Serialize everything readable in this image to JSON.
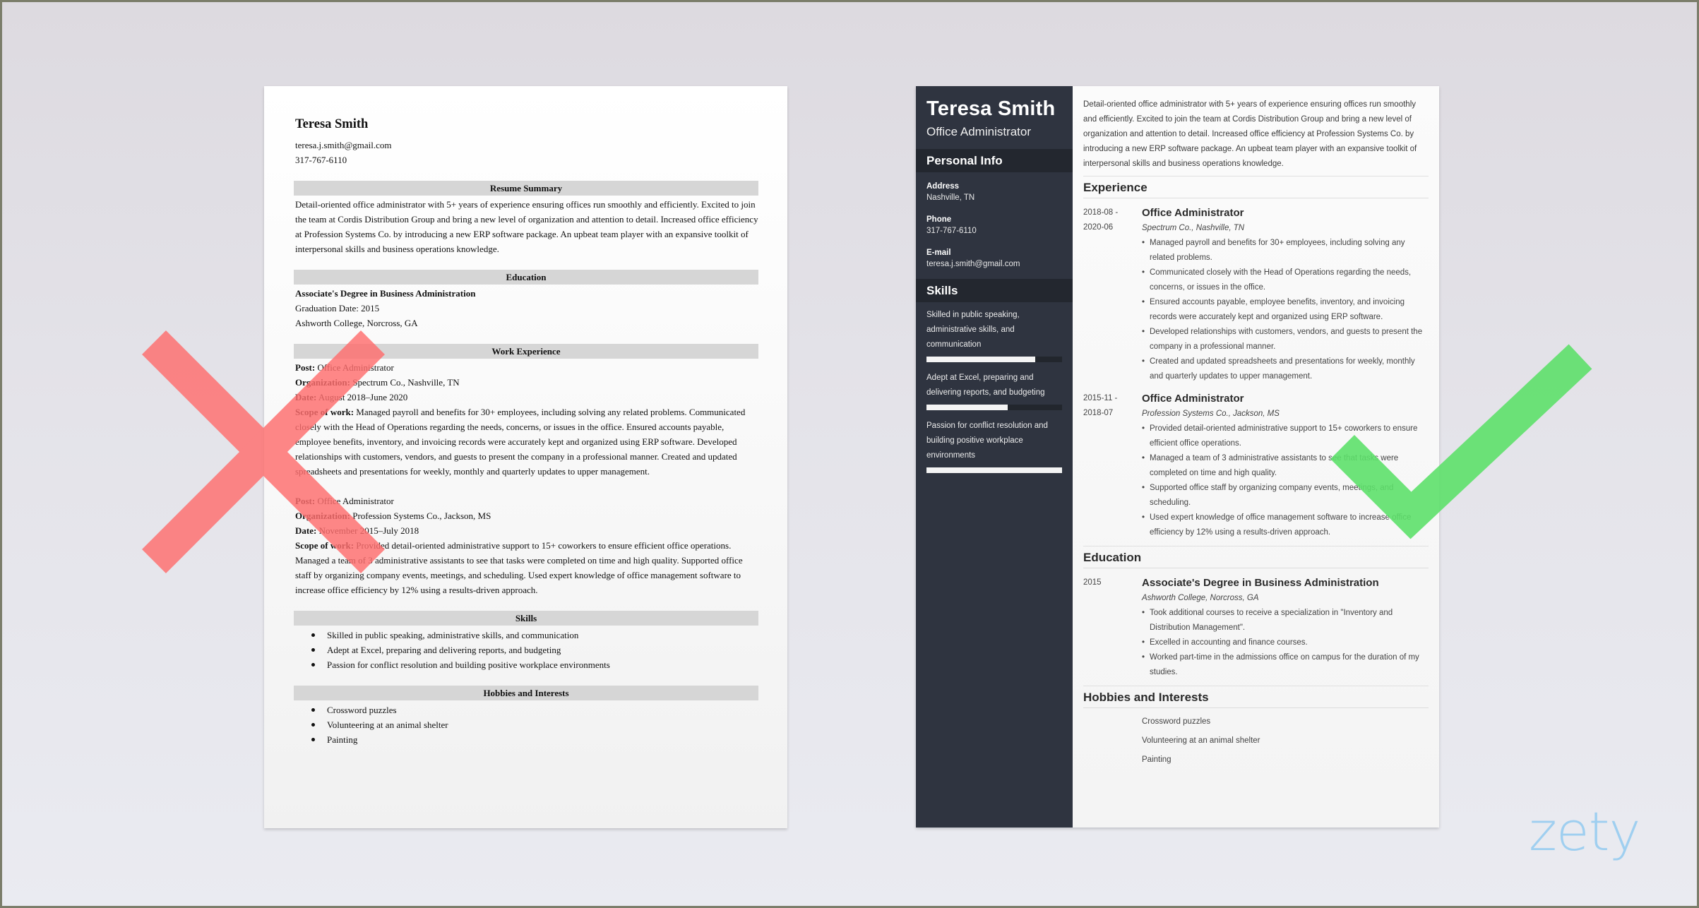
{
  "colors": {
    "bad_mark": "#ff6e6e",
    "good_mark": "#5de06a",
    "sidebar": "#2f3440",
    "sidebar_band": "#23272f",
    "logo": "#9fcff0"
  },
  "marks": {
    "bad": "x-icon",
    "good": "checkmark-icon"
  },
  "logo": {
    "text": "zety"
  },
  "left_resume": {
    "name": "Teresa Smith",
    "email": "teresa.j.smith@gmail.com",
    "phone": "317-767-6110",
    "summary_heading": "Resume Summary",
    "summary": "Detail-oriented office administrator with 5+ years of experience ensuring offices run smoothly and efficiently. Excited to join the team at Cordis Distribution Group and bring a new level of organization and attention to detail. Increased office efficiency at Profession Systems Co. by introducing a new ERP software package. An upbeat team player with an expansive toolkit of interpersonal skills and business operations knowledge.",
    "education_heading": "Education",
    "education": {
      "degree": "Associate's Degree in Business Administration",
      "graduation": "Graduation Date: 2015",
      "school": "Ashworth College, Norcross, GA"
    },
    "experience_heading": "Work Experience",
    "labels": {
      "post": "Post:",
      "organization": "Organization:",
      "date": "Date:",
      "scope": "Scope of work:"
    },
    "jobs": [
      {
        "post": "Office Administrator",
        "organization": "Spectrum Co., Nashville, TN",
        "date": "August 2018–June 2020",
        "scope": "Managed payroll and benefits for 30+ employees, including solving any related problems. Communicated closely with the Head of Operations regarding the needs, concerns, or issues in the office. Ensured accounts payable, employee benefits, inventory, and invoicing records were accurately kept and organized using ERP software. Developed relationships with customers, vendors, and guests to present the company in a professional manner. Created and updated spreadsheets and presentations for weekly, monthly and quarterly updates to upper management."
      },
      {
        "post": "Office Administrator",
        "organization": "Profession Systems Co., Jackson, MS",
        "date": "November 2015–July 2018",
        "scope": "Provided detail-oriented administrative support to 15+ coworkers to ensure efficient office operations. Managed a team of 3 administrative assistants to see that tasks were completed on time and high quality. Supported office staff by organizing company events, meetings, and scheduling. Used expert knowledge of office management software to increase office efficiency by 12% using a results-driven approach."
      }
    ],
    "skills_heading": "Skills",
    "skills": [
      "Skilled in public speaking, administrative skills, and communication",
      "Adept at Excel, preparing and delivering reports, and budgeting",
      "Passion for conflict resolution and building positive workplace environments"
    ],
    "hobbies_heading": "Hobbies and Interests",
    "hobbies": [
      "Crossword puzzles",
      "Volunteering at an animal shelter",
      "Painting"
    ]
  },
  "right_resume": {
    "name": "Teresa Smith",
    "title": "Office Administrator",
    "personal_heading": "Personal Info",
    "personal": [
      {
        "label": "Address",
        "value": "Nashville, TN"
      },
      {
        "label": "Phone",
        "value": "317-767-6110"
      },
      {
        "label": "E-mail",
        "value": "teresa.j.smith@gmail.com"
      }
    ],
    "skills_heading": "Skills",
    "skills": [
      {
        "text": "Skilled in public speaking, administrative skills, and communication",
        "level_pct": 80
      },
      {
        "text": "Adept at Excel, preparing and delivering reports, and budgeting",
        "level_pct": 60
      },
      {
        "text": "Passion for conflict resolution and building positive workplace environments",
        "level_pct": 100
      }
    ],
    "summary": "Detail-oriented office administrator with 5+ years of experience ensuring offices run smoothly and efficiently. Excited to join the team at Cordis Distribution Group and bring a new level of organization and attention to detail. Increased office efficiency at Profession Systems Co. by introducing a new ERP software package. An upbeat team player with an expansive toolkit of interpersonal skills and business operations knowledge.",
    "experience_heading": "Experience",
    "jobs": [
      {
        "date_start": "2018-08 -",
        "date_end": "2020-06",
        "role": "Office Administrator",
        "org": "Spectrum Co., Nashville, TN",
        "bullets": [
          "Managed payroll and benefits for 30+ employees, including solving any related problems.",
          "Communicated closely with the Head of Operations regarding the needs, concerns, or issues in the office.",
          "Ensured accounts payable, employee benefits, inventory, and invoicing records were accurately kept and organized using ERP software.",
          "Developed relationships with customers, vendors, and guests to present the company in a professional manner.",
          "Created and updated spreadsheets and presentations for weekly, monthly and quarterly updates to upper management."
        ]
      },
      {
        "date_start": "2015-11 -",
        "date_end": "2018-07",
        "role": "Office Administrator",
        "org": "Profession Systems Co., Jackson, MS",
        "bullets": [
          "Provided detail-oriented administrative support to 15+ coworkers to ensure efficient office operations.",
          "Managed a team of 3 administrative assistants to see that tasks were completed on time and high quality.",
          "Supported office staff by organizing company events, meetings, and scheduling.",
          "Used expert knowledge of office management software to increase office efficiency by 12% using a results-driven approach."
        ]
      }
    ],
    "education_heading": "Education",
    "education": {
      "year": "2015",
      "degree": "Associate's Degree in Business Administration",
      "school": "Ashworth College, Norcross, GA",
      "bullets": [
        "Took additional courses to receive a specialization in \"Inventory and Distribution Management\".",
        "Excelled in accounting and finance courses.",
        "Worked part-time in the admissions office on campus for the duration of my studies."
      ]
    },
    "hobbies_heading": "Hobbies and Interests",
    "hobbies": [
      "Crossword puzzles",
      "Volunteering at an animal shelter",
      "Painting"
    ]
  }
}
